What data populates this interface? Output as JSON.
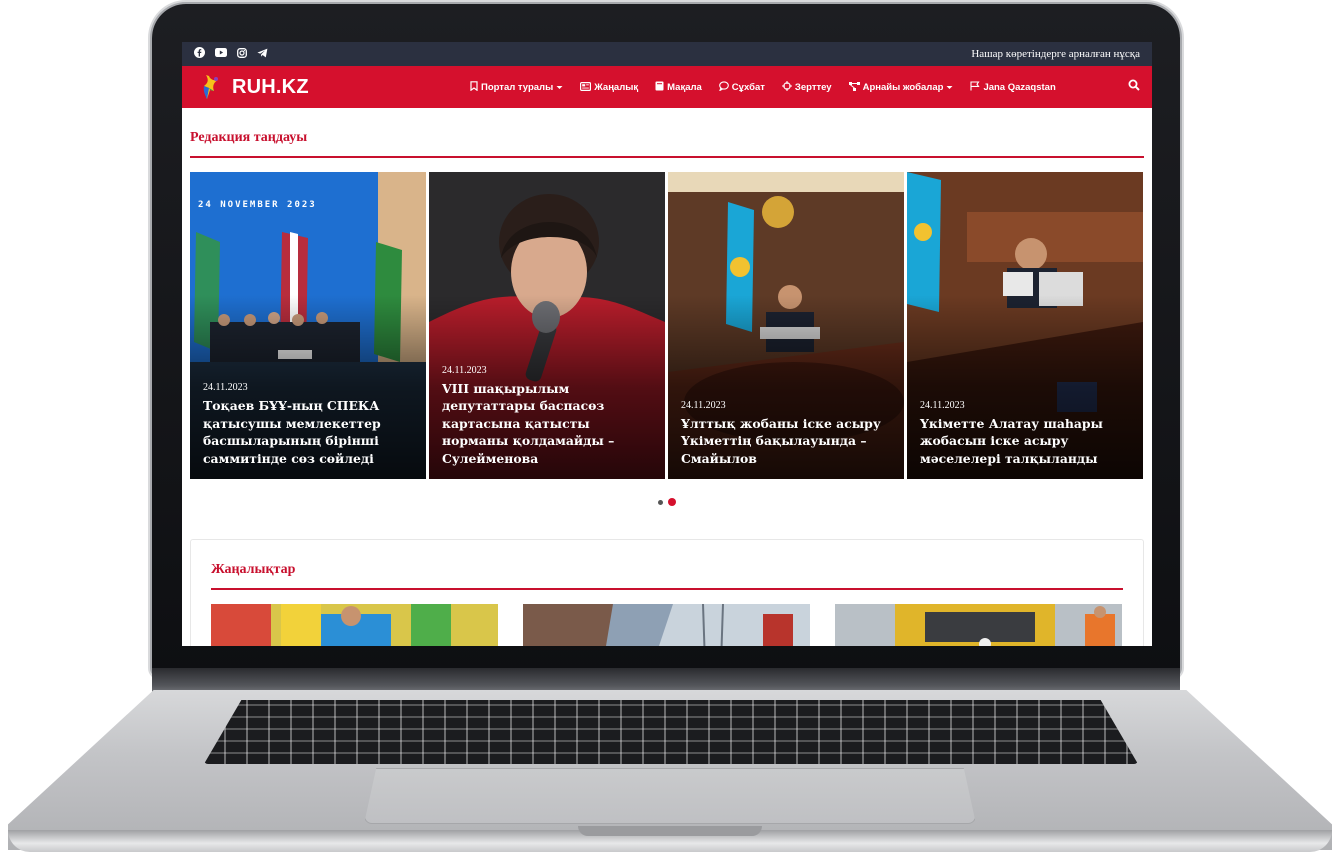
{
  "topbar": {
    "social_icons": [
      "facebook-icon",
      "youtube-icon",
      "instagram-icon",
      "telegram-icon"
    ],
    "accessible_version": "Нашар көретіндерге арналған нұсқа"
  },
  "header": {
    "logo_text": "RUH.KZ",
    "menu": [
      {
        "icon": "bookmark-icon",
        "label": "Портал туралы",
        "dropdown": true
      },
      {
        "icon": "newspaper-icon",
        "label": "Жаңалық",
        "dropdown": false
      },
      {
        "icon": "book-icon",
        "label": "Мақала",
        "dropdown": false
      },
      {
        "icon": "chat-icon",
        "label": "Сұхбат",
        "dropdown": false
      },
      {
        "icon": "crosshair-icon",
        "label": "Зерттеу",
        "dropdown": false
      },
      {
        "icon": "project-diagram-icon",
        "label": "Арнайы жобалар",
        "dropdown": true
      },
      {
        "icon": "flag-icon",
        "label": "Jana Qazaqstan",
        "dropdown": false
      }
    ],
    "search_icon": "search-icon"
  },
  "editors_choice": {
    "title": "Редакция таңдауы",
    "slides": [
      {
        "date": "24.11.2023",
        "title": "Тоқаев БҰҰ-ның СПЕКА қатысушы мемлекеттер басшыларының бірінші саммитінде сөз сөйледі",
        "image_caption": "24 NOVEMBER 2023"
      },
      {
        "date": "24.11.2023",
        "title": "VIII шақырылым депутаттары баспасөз картасына қатысты норманы қолдамайды – Сулейменова"
      },
      {
        "date": "24.11.2023",
        "title": "Ұлттық жобаны іске асыру Үкіметтің бақылауында – Смайылов"
      },
      {
        "date": "24.11.2023",
        "title": "Үкіметте Алатау шаһары жобасын іске асыру мәселелері талқыланды"
      }
    ],
    "pagination": {
      "pages": 2,
      "active": 2
    }
  },
  "news": {
    "title": "Жаңалықтар"
  },
  "colors": {
    "brand_red": "#d5102d",
    "topbar": "#2b3040"
  }
}
